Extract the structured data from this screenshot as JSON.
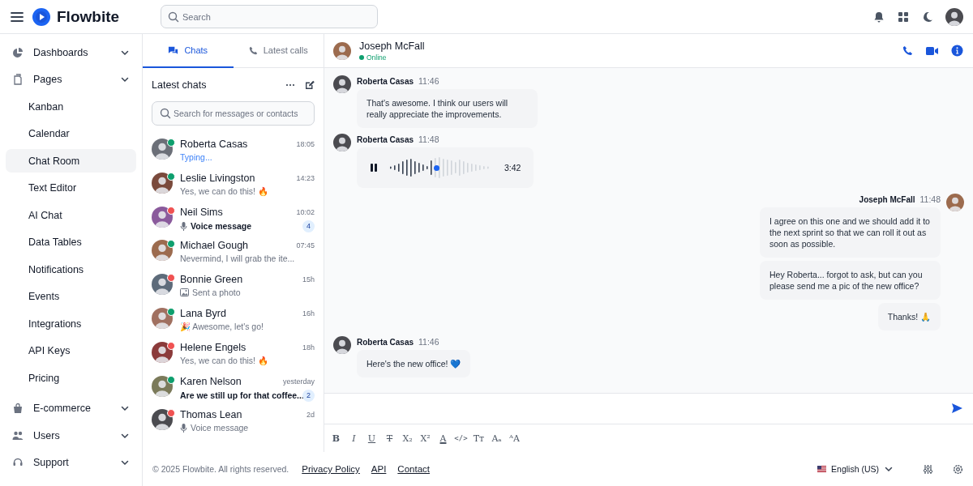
{
  "header": {
    "brand": "Flowbite",
    "search": {
      "placeholder": "Search"
    }
  },
  "sidebar": {
    "items": [
      {
        "label": "Dashboards",
        "selected": false
      },
      {
        "label": "Pages",
        "selected": false,
        "children": [
          {
            "label": "Kanban",
            "selected": false
          },
          {
            "label": "Calendar",
            "selected": false
          },
          {
            "label": "Chat Room",
            "selected": true
          },
          {
            "label": "Text Editor",
            "selected": false
          },
          {
            "label": "AI Chat",
            "selected": false
          },
          {
            "label": "Data Tables",
            "selected": false
          },
          {
            "label": "Notifications",
            "selected": false
          },
          {
            "label": "Events",
            "selected": false
          },
          {
            "label": "Integrations",
            "selected": false
          },
          {
            "label": "API Keys",
            "selected": false
          },
          {
            "label": "Pricing",
            "selected": false
          }
        ]
      },
      {
        "label": "E-commerce",
        "selected": false
      },
      {
        "label": "Users",
        "selected": false
      },
      {
        "label": "Support",
        "selected": false
      }
    ]
  },
  "chat_list": {
    "tabs": [
      {
        "label": "Chats",
        "selected": true
      },
      {
        "label": "Latest calls",
        "selected": false
      }
    ],
    "title": "Latest chats",
    "search": {
      "placeholder": "Search for messages or contacts"
    },
    "chats": [
      {
        "name": "Roberta Casas",
        "time": "18:05",
        "online": true,
        "preview": {
          "kind": "typing",
          "text": "Typing..."
        }
      },
      {
        "name": "Leslie Livingston",
        "time": "14:23",
        "online": true,
        "preview": {
          "kind": "text",
          "text": "Yes, we can do this! 🔥"
        }
      },
      {
        "name": "Neil Sims",
        "time": "10:02",
        "online": false,
        "unread": "4",
        "preview": {
          "kind": "voice",
          "text": "Voice message"
        }
      },
      {
        "name": "Michael Gough",
        "time": "07:45",
        "online": true,
        "preview": {
          "kind": "text",
          "text": "Nevermind, I will grab the ite..."
        }
      },
      {
        "name": "Bonnie Green",
        "time": "15h",
        "online": false,
        "preview": {
          "kind": "photo",
          "text": "Sent a photo"
        }
      },
      {
        "name": "Lana Byrd",
        "time": "16h",
        "online": true,
        "preview": {
          "kind": "text",
          "text": "🎉 Awesome, let's go!"
        }
      },
      {
        "name": "Helene Engels",
        "time": "18h",
        "online": false,
        "preview": {
          "kind": "text",
          "text": "Yes, we can do this! 🔥"
        }
      },
      {
        "name": "Karen Nelson",
        "time": "yesterday",
        "online": true,
        "unread": "2",
        "preview": {
          "kind": "text",
          "text": "Are we still up for that coffee..."
        }
      },
      {
        "name": "Thomas Lean",
        "time": "2d",
        "online": false,
        "preview": {
          "kind": "voice",
          "text": "Voice message"
        }
      }
    ]
  },
  "conversation": {
    "contact": {
      "name": "Joseph McFall",
      "status": "Online"
    },
    "messages": [
      {
        "outgoing": false,
        "kind": "text",
        "sender": "Roberta Casas",
        "time": "11:46",
        "bubbles": [
          "That's awesome. I think our users will really appreciate the improvements."
        ]
      },
      {
        "outgoing": false,
        "kind": "voice",
        "sender": "Roberta Casas",
        "time": "11:48",
        "duration": "3:42",
        "level": 0.45
      },
      {
        "outgoing": true,
        "kind": "text",
        "sender": "Joseph McFall",
        "time": "11:48",
        "bubbles": [
          "I agree on this one and we should add it to the next sprint so that we can roll it out as soon as possible.",
          "Hey Roberta... forgot to ask, but can you please send me a pic of the new office?",
          "Thanks! 🙏"
        ]
      },
      {
        "outgoing": false,
        "kind": "text",
        "sender": "Roberta Casas",
        "time": "11:46",
        "bubbles": [
          "Here's the new office! 💙"
        ]
      }
    ],
    "formatting": [
      {
        "kind": "bold",
        "label": "B"
      },
      {
        "kind": "italic",
        "label": "I"
      },
      {
        "kind": "underline",
        "label": "U"
      },
      {
        "kind": "strike",
        "label": "T"
      },
      {
        "kind": "subscript",
        "label": "X₂"
      },
      {
        "kind": "superscript",
        "label": "X²"
      },
      {
        "kind": "color",
        "label": "A"
      },
      {
        "kind": "code",
        "label": "</>"
      },
      {
        "kind": "size",
        "label": "Tт"
      },
      {
        "kind": "font",
        "label": "Aₐ"
      },
      {
        "kind": "case",
        "label": "ᴬA"
      }
    ]
  },
  "footer": {
    "copyright": "© 2025 Flowbite. All rights reserved.",
    "links": [
      "Privacy Policy",
      "API",
      "Contact"
    ],
    "language": "English (US)"
  }
}
